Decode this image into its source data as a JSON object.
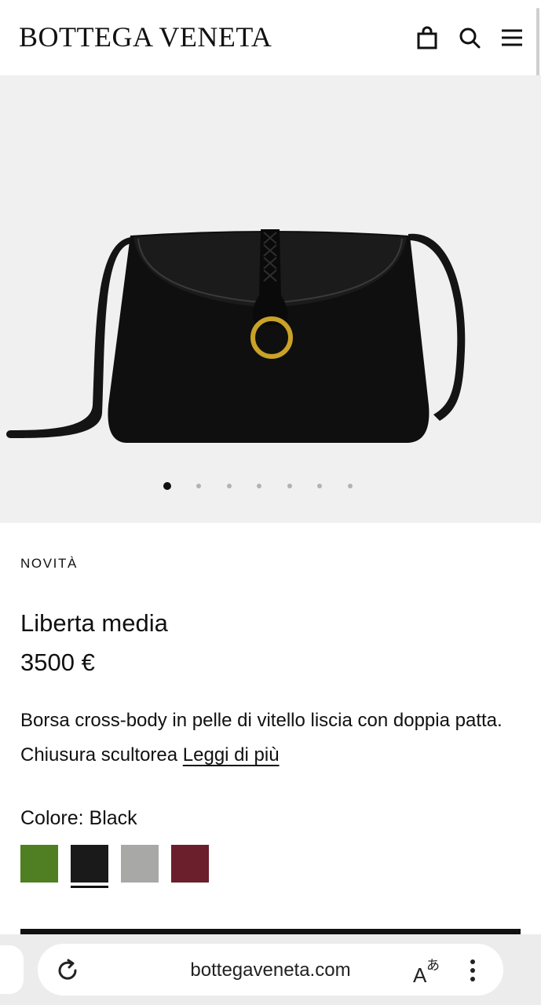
{
  "header": {
    "brand": "BOTTEGA VENETA",
    "icons": [
      "shopping-bag-icon",
      "search-icon",
      "menu-icon"
    ]
  },
  "gallery": {
    "slide_count": 7,
    "active_slide": 1
  },
  "product": {
    "badge": "NOVITÀ",
    "name": "Liberta media",
    "price": "3500 €",
    "description": "Borsa cross-body in pelle di vitello liscia con doppia patta. Chiusura scultorea",
    "read_more": "Leggi di più",
    "color_label": "Colore:",
    "color_value": "Black",
    "swatches": [
      {
        "name": "green",
        "color": "#4f7f22"
      },
      {
        "name": "black",
        "color": "#1a1a1a",
        "selected": true
      },
      {
        "name": "grey",
        "color": "#a8a9a6"
      },
      {
        "name": "burgundy",
        "color": "#6b1e2b"
      }
    ]
  },
  "browser": {
    "url": "bottegaveneta.com",
    "icons": [
      "reload-icon",
      "translate-icon",
      "more-vert-icon"
    ]
  }
}
